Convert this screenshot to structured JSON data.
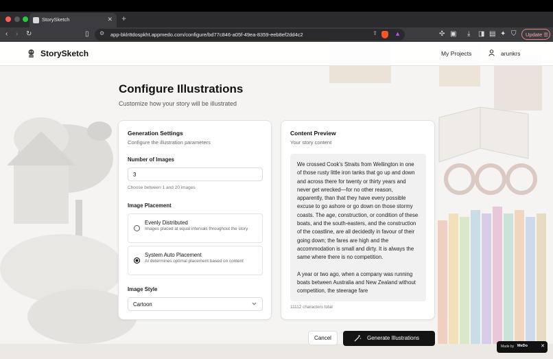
{
  "browser": {
    "tab_title": "StorySketch",
    "url": "app-bklr8dospkht.appmedo.com/configure/bd77c846-a05f-49ea-8359-eeb8ef2dd4c2",
    "update_label": "Update"
  },
  "header": {
    "brand": "StorySketch",
    "nav_projects": "My Projects",
    "username": "arunkrs"
  },
  "page": {
    "title": "Configure Illustrations",
    "subtitle": "Customize how your story will be illustrated"
  },
  "settings": {
    "title": "Generation Settings",
    "subtitle": "Configure the illustration parameters",
    "num_images_label": "Number of Images",
    "num_images_value": "3",
    "num_images_hint": "Choose between 1 and 20 images",
    "placement_label": "Image Placement",
    "placement_options": [
      {
        "title": "Evenly Distributed",
        "desc": "Images placed at equal intervals throughout the story",
        "selected": false
      },
      {
        "title": "System Auto Placement",
        "desc": "AI determines optimal placement based on content",
        "selected": true
      }
    ],
    "style_label": "Image Style",
    "style_value": "Cartoon"
  },
  "preview": {
    "title": "Content Preview",
    "subtitle": "Your story content",
    "paragraphs": [
      "We crossed Cook's Straits from Wellington in one of those rusty little iron tanks that go up and down and across there for twenty or thirty years and never get wrecked—for no other reason, apparently, than that they have every possible excuse to go ashore or go down on those stormy coasts. The age, construction, or condition of these boats, and the south-easters, and the construction of the coastline, are all decidedly in favour of their going down; the fares are high and the accommodation is small and dirty. It is always the same where there is no competition.",
      "A year or two ago, when a company was running boats between Australia and New Zealand without competition, the steerage fare"
    ],
    "char_count": "11112 characters total"
  },
  "actions": {
    "cancel": "Cancel",
    "generate": "Generate Illustrations"
  },
  "badge": {
    "made_by": "Made by",
    "brand": "MeDo"
  },
  "colors": {
    "primary_button": "#141414",
    "page_bg": "#f4f3f1",
    "card_bg": "#ffffff"
  }
}
